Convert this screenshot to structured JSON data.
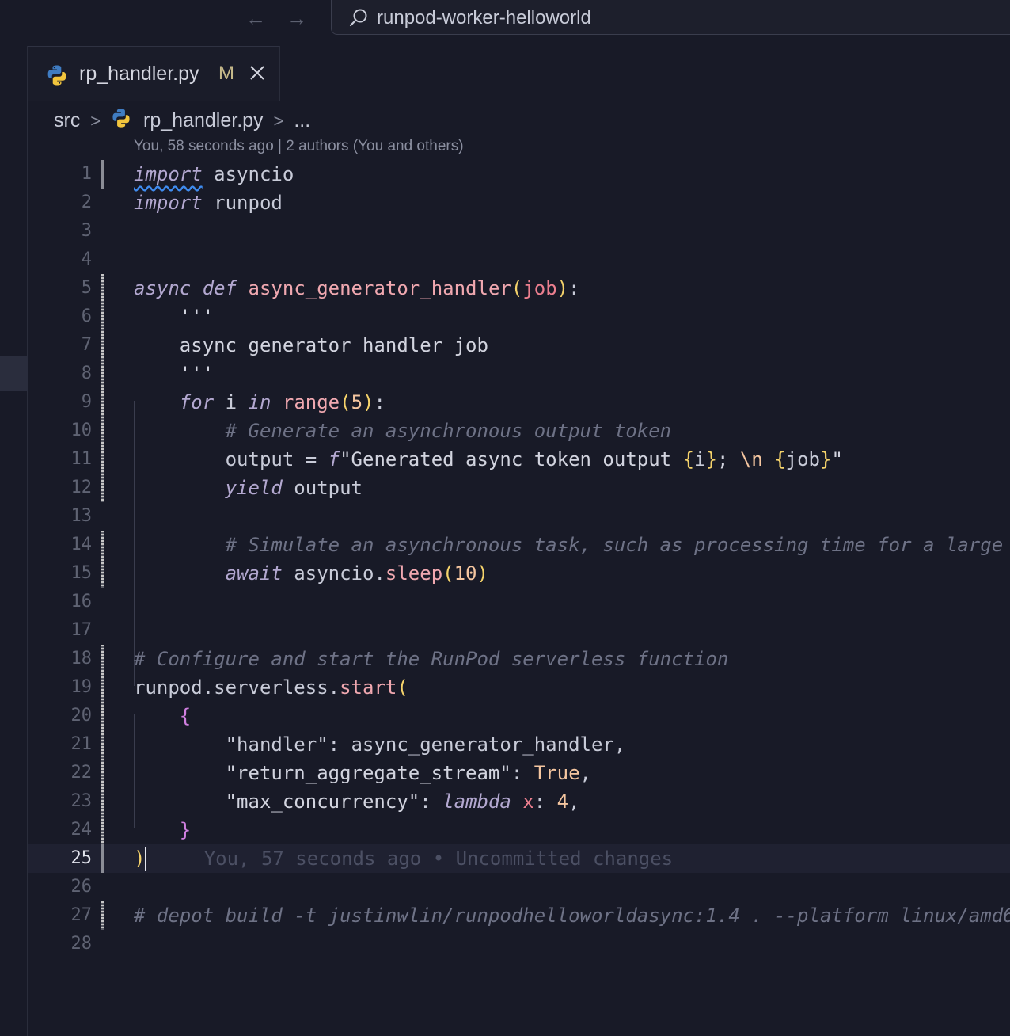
{
  "titlebar": {
    "back_arrow": "←",
    "forward_arrow": "→",
    "search_text": "runpod-worker-helloworld"
  },
  "tab": {
    "filename": "rp_handler.py",
    "modified_badge": "M",
    "icons": [
      "python-file-icon",
      "close-icon"
    ]
  },
  "breadcrumb": {
    "folder": "src",
    "file": "rp_handler.py",
    "more": "...",
    "separator": ">"
  },
  "codelens": "You, 58 seconds ago | 2 authors (You and others)",
  "blame": "You, 57 seconds ago • Uncommitted changes",
  "editor": {
    "current_line": 25,
    "line_numbers": [
      "1",
      "2",
      "3",
      "4",
      "5",
      "6",
      "7",
      "8",
      "9",
      "10",
      "11",
      "12",
      "13",
      "14",
      "15",
      "16",
      "17",
      "18",
      "19",
      "20",
      "21",
      "22",
      "23",
      "24",
      "25",
      "26",
      "27",
      "28"
    ],
    "lines": [
      "import asyncio",
      "import runpod",
      "",
      "",
      "async def async_generator_handler(job):",
      "    '''",
      "    async generator handler job",
      "    '''",
      "    for i in range(5):",
      "        # Generate an asynchronous output token",
      "        output = f\"Generated async token output {i}; \\n {job}\"",
      "        yield output",
      "",
      "        # Simulate an asynchronous task, such as processing time for a large",
      "        await asyncio.sleep(10)",
      "",
      "",
      "# Configure and start the RunPod serverless function",
      "runpod.serverless.start(",
      "    {",
      "        \"handler\": async_generator_handler,",
      "        \"return_aggregate_stream\": True,",
      "        \"max_concurrency\": lambda x: 4,",
      "    }",
      ")",
      "",
      "# depot build -t justinwlin/runpodhelloworldasync:1.4 . --platform linux/amd6",
      ""
    ],
    "colors": {
      "background": "#181a27",
      "keyword": "#b3a8d0",
      "function": "#f0a8b0",
      "comment": "#6e7286",
      "number": "#f5c6a0",
      "bracket": "#f5d36b"
    }
  }
}
